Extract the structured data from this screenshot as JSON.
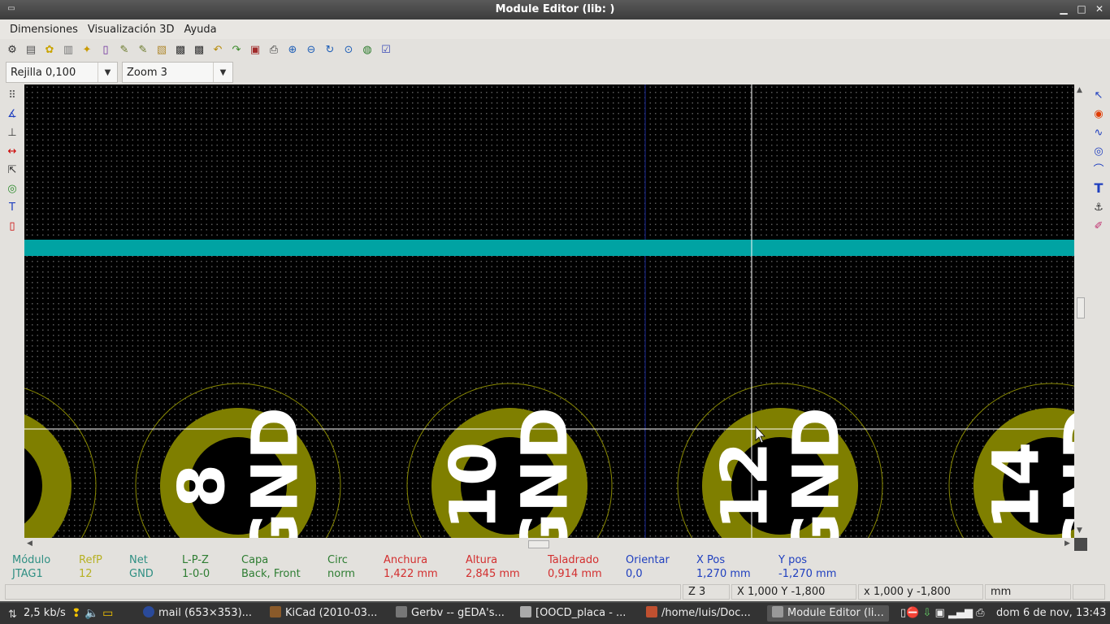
{
  "window": {
    "title": "Module Editor (lib: )"
  },
  "menu": [
    "Dimensiones",
    "Visualización 3D",
    "Ayuda"
  ],
  "selectors": {
    "grid": "Rejilla 0,100",
    "zoom": "Zoom 3"
  },
  "info_panel": {
    "columns": [
      {
        "header": "Módulo",
        "value": "JTAG1",
        "color": "#2f8f83"
      },
      {
        "header": "RefP",
        "value": "12",
        "color": "#b7b124"
      },
      {
        "header": "Net",
        "value": "GND",
        "color": "#2f8f83"
      },
      {
        "header": "L-P-Z",
        "value": "1-0-0",
        "color": "#2e7d32"
      },
      {
        "header": "Capa",
        "value": "Back, Front",
        "color": "#2e7d32"
      },
      {
        "header": "Circ",
        "value": "norm",
        "color": "#2e7d32"
      },
      {
        "header": "Anchura",
        "value": "1,422 mm",
        "color": "#d32f2f"
      },
      {
        "header": "Altura",
        "value": "2,845 mm",
        "color": "#d32f2f"
      },
      {
        "header": "Taladrado",
        "value": "0,914 mm",
        "color": "#d32f2f"
      },
      {
        "header": "Orientar",
        "value": "0,0",
        "color": "#1f3fbf"
      },
      {
        "header": "X Pos",
        "value": "1,270 mm",
        "color": "#1f3fbf"
      },
      {
        "header": "Y pos",
        "value": "-1,270 mm",
        "color": "#1f3fbf"
      }
    ]
  },
  "status": {
    "zoom": "Z 3",
    "abs_coords": "X 1,000  Y -1,800",
    "rel_coords": "x 1,000  y -1,800",
    "units": "mm"
  },
  "canvas": {
    "pad_labels": [
      "8",
      "10",
      "12",
      "14"
    ],
    "net_label": "GND",
    "colors": {
      "pad": "#7f7f00",
      "track": "#00a3a3",
      "text": "#ffffff"
    }
  },
  "taskbar": {
    "netspeed": "2,5 kb/s",
    "items": [
      "mail (653×353)...",
      "KiCad (2010-03...",
      "Gerbv -- gEDA's...",
      "[OOCD_placa - ...",
      "/home/luis/Doc...",
      "Module Editor (li..."
    ],
    "clock": "dom  6 de nov, 13:43"
  }
}
